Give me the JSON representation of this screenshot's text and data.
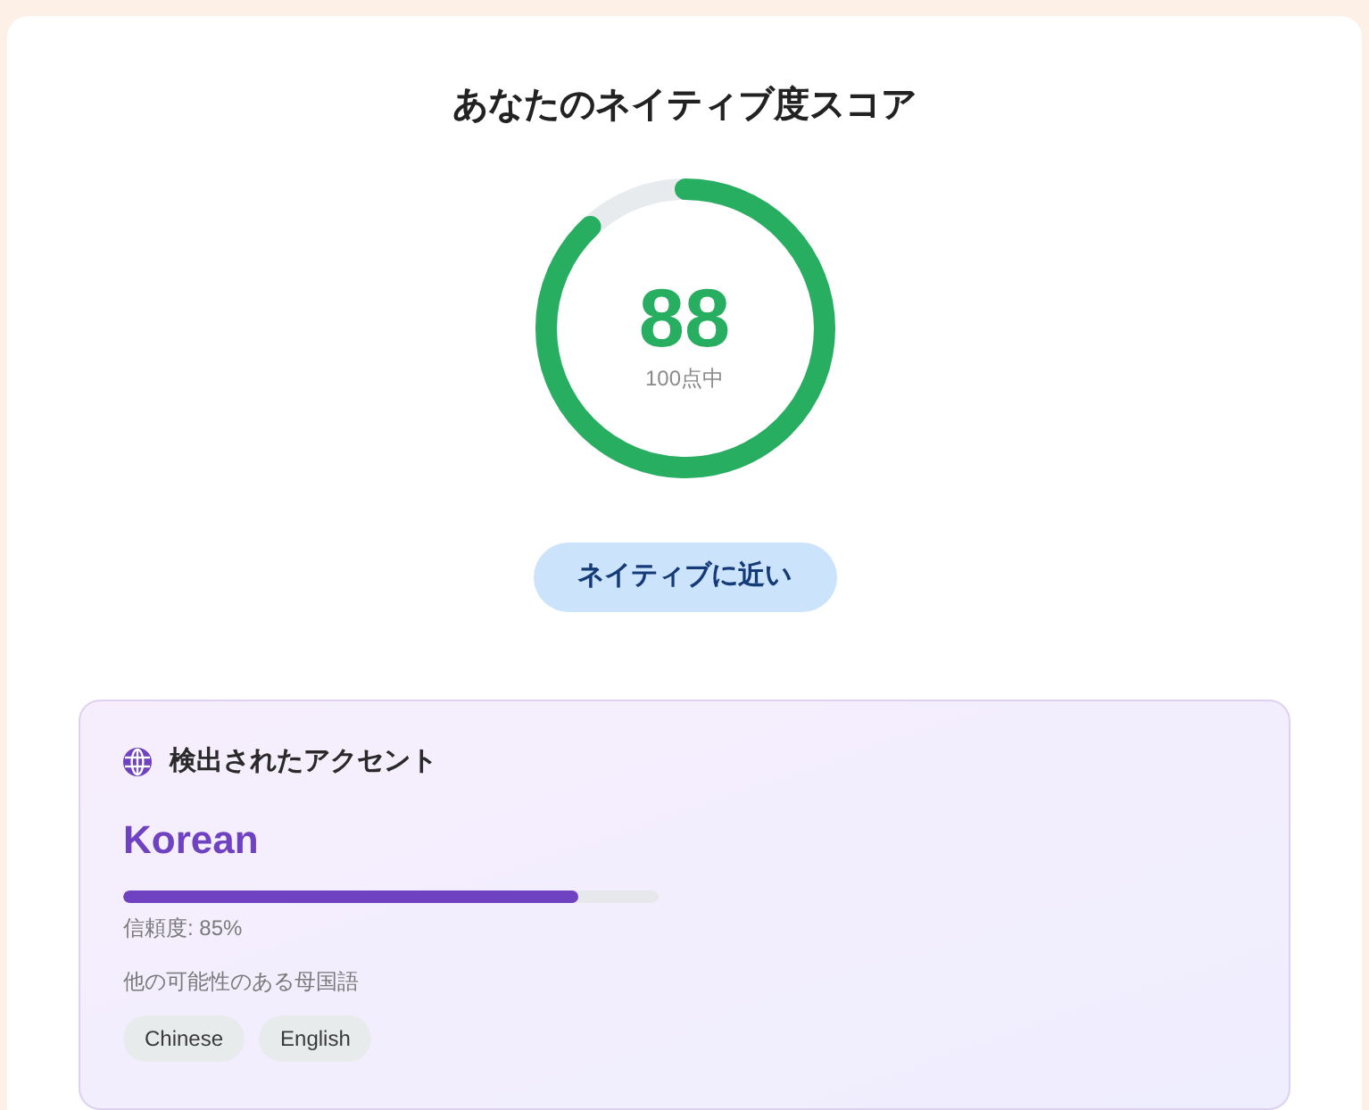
{
  "title": "あなたのネイティブ度スコア",
  "score": {
    "value": "88",
    "caption": "100点中",
    "level": 0.88
  },
  "badge": {
    "label": "ネイティブに近い"
  },
  "accent": {
    "heading": "検出されたアクセント",
    "language": "Korean",
    "confidence": {
      "level": 0.85,
      "reading": "信頼度: 85%"
    },
    "alternatives_label": "他の可能性のある母国語",
    "alternatives": [
      "Chinese",
      "English"
    ]
  }
}
